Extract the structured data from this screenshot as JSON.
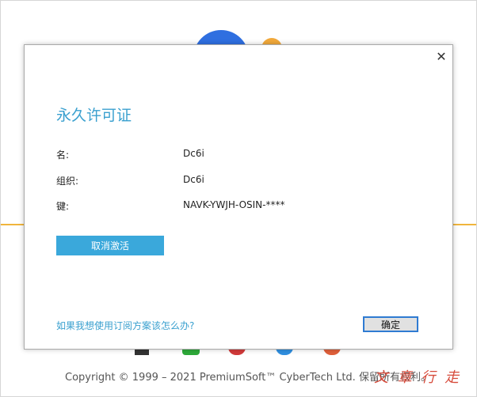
{
  "dialog": {
    "title": "永久许可证",
    "close_glyph": "✕",
    "fields": [
      {
        "label": "名:",
        "value": "Dc6i"
      },
      {
        "label": "组织:",
        "value": "Dc6i"
      },
      {
        "label": "键:",
        "value": "NAVK-YWJH-OSIN-****"
      }
    ],
    "deactivate_label": "取消激活",
    "subscription_link": "如果我想使用订阅方案该怎么办?",
    "ok_label": "确定"
  },
  "background": {
    "copyright": "Copyright © 1999 – 2021 PremiumSoft™ CyberTech Ltd. 保留所有权利。",
    "watermark": "文 章 行 走"
  },
  "colors": {
    "accent": "#3aa0cf",
    "button_fill": "#3aa8db",
    "focus_border": "#2f7bd2",
    "bg_line": "#f0b53c"
  },
  "icons": {
    "close": "close-icon"
  }
}
